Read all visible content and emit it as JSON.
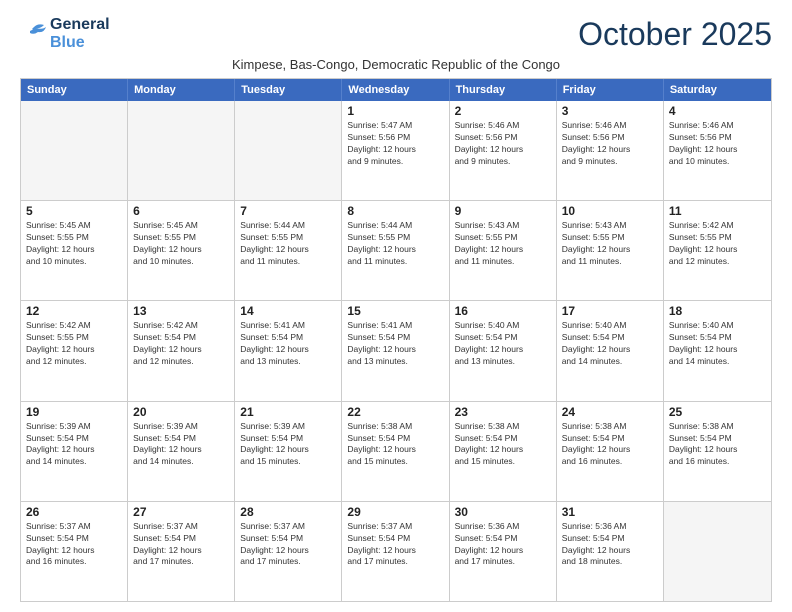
{
  "logo": {
    "line1": "General",
    "line2": "Blue"
  },
  "title": "October 2025",
  "location": "Kimpese, Bas-Congo, Democratic Republic of the Congo",
  "headers": [
    "Sunday",
    "Monday",
    "Tuesday",
    "Wednesday",
    "Thursday",
    "Friday",
    "Saturday"
  ],
  "weeks": [
    [
      {
        "day": "",
        "info": ""
      },
      {
        "day": "",
        "info": ""
      },
      {
        "day": "",
        "info": ""
      },
      {
        "day": "1",
        "info": "Sunrise: 5:47 AM\nSunset: 5:56 PM\nDaylight: 12 hours\nand 9 minutes."
      },
      {
        "day": "2",
        "info": "Sunrise: 5:46 AM\nSunset: 5:56 PM\nDaylight: 12 hours\nand 9 minutes."
      },
      {
        "day": "3",
        "info": "Sunrise: 5:46 AM\nSunset: 5:56 PM\nDaylight: 12 hours\nand 9 minutes."
      },
      {
        "day": "4",
        "info": "Sunrise: 5:46 AM\nSunset: 5:56 PM\nDaylight: 12 hours\nand 10 minutes."
      }
    ],
    [
      {
        "day": "5",
        "info": "Sunrise: 5:45 AM\nSunset: 5:55 PM\nDaylight: 12 hours\nand 10 minutes."
      },
      {
        "day": "6",
        "info": "Sunrise: 5:45 AM\nSunset: 5:55 PM\nDaylight: 12 hours\nand 10 minutes."
      },
      {
        "day": "7",
        "info": "Sunrise: 5:44 AM\nSunset: 5:55 PM\nDaylight: 12 hours\nand 11 minutes."
      },
      {
        "day": "8",
        "info": "Sunrise: 5:44 AM\nSunset: 5:55 PM\nDaylight: 12 hours\nand 11 minutes."
      },
      {
        "day": "9",
        "info": "Sunrise: 5:43 AM\nSunset: 5:55 PM\nDaylight: 12 hours\nand 11 minutes."
      },
      {
        "day": "10",
        "info": "Sunrise: 5:43 AM\nSunset: 5:55 PM\nDaylight: 12 hours\nand 11 minutes."
      },
      {
        "day": "11",
        "info": "Sunrise: 5:42 AM\nSunset: 5:55 PM\nDaylight: 12 hours\nand 12 minutes."
      }
    ],
    [
      {
        "day": "12",
        "info": "Sunrise: 5:42 AM\nSunset: 5:55 PM\nDaylight: 12 hours\nand 12 minutes."
      },
      {
        "day": "13",
        "info": "Sunrise: 5:42 AM\nSunset: 5:54 PM\nDaylight: 12 hours\nand 12 minutes."
      },
      {
        "day": "14",
        "info": "Sunrise: 5:41 AM\nSunset: 5:54 PM\nDaylight: 12 hours\nand 13 minutes."
      },
      {
        "day": "15",
        "info": "Sunrise: 5:41 AM\nSunset: 5:54 PM\nDaylight: 12 hours\nand 13 minutes."
      },
      {
        "day": "16",
        "info": "Sunrise: 5:40 AM\nSunset: 5:54 PM\nDaylight: 12 hours\nand 13 minutes."
      },
      {
        "day": "17",
        "info": "Sunrise: 5:40 AM\nSunset: 5:54 PM\nDaylight: 12 hours\nand 14 minutes."
      },
      {
        "day": "18",
        "info": "Sunrise: 5:40 AM\nSunset: 5:54 PM\nDaylight: 12 hours\nand 14 minutes."
      }
    ],
    [
      {
        "day": "19",
        "info": "Sunrise: 5:39 AM\nSunset: 5:54 PM\nDaylight: 12 hours\nand 14 minutes."
      },
      {
        "day": "20",
        "info": "Sunrise: 5:39 AM\nSunset: 5:54 PM\nDaylight: 12 hours\nand 14 minutes."
      },
      {
        "day": "21",
        "info": "Sunrise: 5:39 AM\nSunset: 5:54 PM\nDaylight: 12 hours\nand 15 minutes."
      },
      {
        "day": "22",
        "info": "Sunrise: 5:38 AM\nSunset: 5:54 PM\nDaylight: 12 hours\nand 15 minutes."
      },
      {
        "day": "23",
        "info": "Sunrise: 5:38 AM\nSunset: 5:54 PM\nDaylight: 12 hours\nand 15 minutes."
      },
      {
        "day": "24",
        "info": "Sunrise: 5:38 AM\nSunset: 5:54 PM\nDaylight: 12 hours\nand 16 minutes."
      },
      {
        "day": "25",
        "info": "Sunrise: 5:38 AM\nSunset: 5:54 PM\nDaylight: 12 hours\nand 16 minutes."
      }
    ],
    [
      {
        "day": "26",
        "info": "Sunrise: 5:37 AM\nSunset: 5:54 PM\nDaylight: 12 hours\nand 16 minutes."
      },
      {
        "day": "27",
        "info": "Sunrise: 5:37 AM\nSunset: 5:54 PM\nDaylight: 12 hours\nand 17 minutes."
      },
      {
        "day": "28",
        "info": "Sunrise: 5:37 AM\nSunset: 5:54 PM\nDaylight: 12 hours\nand 17 minutes."
      },
      {
        "day": "29",
        "info": "Sunrise: 5:37 AM\nSunset: 5:54 PM\nDaylight: 12 hours\nand 17 minutes."
      },
      {
        "day": "30",
        "info": "Sunrise: 5:36 AM\nSunset: 5:54 PM\nDaylight: 12 hours\nand 17 minutes."
      },
      {
        "day": "31",
        "info": "Sunrise: 5:36 AM\nSunset: 5:54 PM\nDaylight: 12 hours\nand 18 minutes."
      },
      {
        "day": "",
        "info": ""
      }
    ]
  ]
}
